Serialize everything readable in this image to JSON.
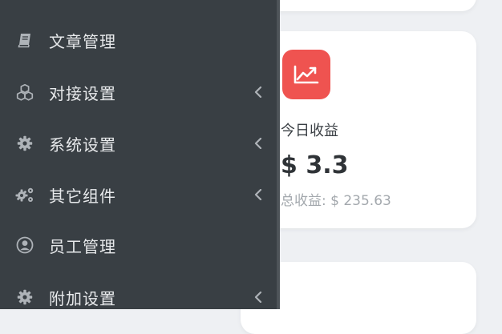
{
  "sidebar": {
    "items": [
      {
        "label": "文章管理",
        "icon": "book-icon",
        "has_submenu": false
      },
      {
        "label": "对接设置",
        "icon": "cubes-icon",
        "has_submenu": true
      },
      {
        "label": "系统设置",
        "icon": "gear-icon",
        "has_submenu": true
      },
      {
        "label": "其它组件",
        "icon": "gears-icon",
        "has_submenu": true
      },
      {
        "label": "员工管理",
        "icon": "user-circle-icon",
        "has_submenu": false
      },
      {
        "label": "附加设置",
        "icon": "gear-icon",
        "has_submenu": true
      }
    ]
  },
  "stat_card": {
    "icon": "chart-line-icon",
    "title": "今日收益",
    "value": "$ 3.3",
    "subtitle": "总收益: $ 235.63"
  },
  "colors": {
    "sidebar_bg": "#393f44",
    "sidebar_text": "#e7e9eb",
    "sidebar_icon": "#aeb3b8",
    "accent_red": "#ef5350",
    "page_bg": "#eef0f3"
  }
}
